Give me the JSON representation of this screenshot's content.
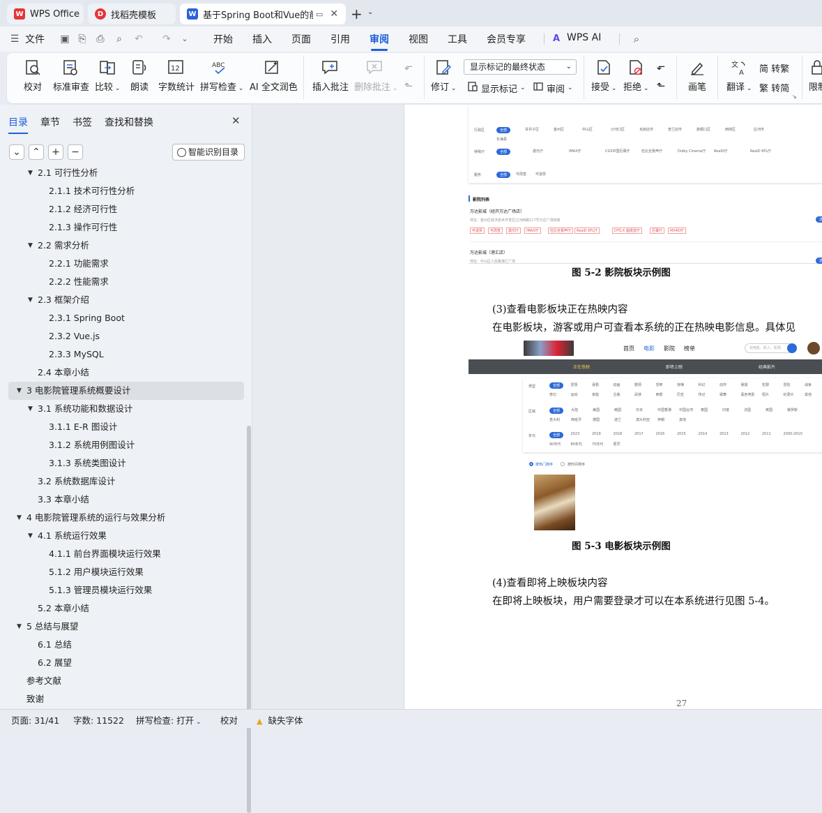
{
  "tabs": [
    {
      "label": "WPS Office",
      "logo": "W",
      "color": "#e5353a"
    },
    {
      "label": "找稻壳模板",
      "logo": "D",
      "color": "#e5353a"
    },
    {
      "label": "基于Spring Boot和Vue的前后",
      "logo": "W",
      "color": "#2b62d8"
    }
  ],
  "menu": {
    "file": "文件",
    "items": [
      "开始",
      "插入",
      "页面",
      "引用",
      "审阅",
      "视图",
      "工具",
      "会员专享"
    ],
    "active": "审阅",
    "ai": "WPS AI"
  },
  "ribbon": {
    "proofread": "校对",
    "std_review": "标准审查",
    "compare": "比较",
    "read_aloud": "朗读",
    "word_count": "字数统计",
    "spell_check": "拼写检查",
    "ai_polish": "AI 全文润色",
    "insert_comment": "插入批注",
    "delete_comment": "删除批注",
    "track": "修订",
    "markup_select": "显示标记的最终状态",
    "show_markup": "显示标记",
    "review_pane": "审阅",
    "accept": "接受",
    "reject": "拒绝",
    "pen": "画笔",
    "translate": "翻译",
    "to_trad": "简 转繁",
    "to_simp": "繁 转简",
    "restrict": "限制"
  },
  "sidebar": {
    "tabs": [
      "目录",
      "章节",
      "书签",
      "查找和替换"
    ],
    "smart_btn": "智能识别目录",
    "toc": [
      {
        "label": "2.1  可行性分析",
        "level": 2,
        "caret": true
      },
      {
        "label": "2.1.1  技术可行性分析",
        "level": 3
      },
      {
        "label": "2.1.2  经济可行性",
        "level": 3
      },
      {
        "label": "2.1.3  操作可行性",
        "level": 3
      },
      {
        "label": "2.2  需求分析",
        "level": 2,
        "caret": true
      },
      {
        "label": "2.2.1  功能需求",
        "level": 3
      },
      {
        "label": "2.2.2  性能需求",
        "level": 3
      },
      {
        "label": "2.3  框架介绍",
        "level": 2,
        "caret": true
      },
      {
        "label": "2.3.1 Spring Boot",
        "level": 3
      },
      {
        "label": "2.3.2 Vue.js",
        "level": 3
      },
      {
        "label": "2.3.3 MySQL",
        "level": 3
      },
      {
        "label": "2.4  本章小结",
        "level": 2
      },
      {
        "label": "3  电影院管理系统概要设计",
        "level": 1,
        "caret": true,
        "selected": true
      },
      {
        "label": "3.1  系统功能和数据设计",
        "level": 2,
        "caret": true
      },
      {
        "label": "3.1.1 E-R 图设计",
        "level": 3
      },
      {
        "label": "3.1.2  系统用例图设计",
        "level": 3
      },
      {
        "label": "3.1.3  系统类图设计",
        "level": 3
      },
      {
        "label": "3.2  系统数据库设计",
        "level": 2
      },
      {
        "label": "3.3  本章小结",
        "level": 2
      },
      {
        "label": "4  电影院管理系统的运行与效果分析",
        "level": 1,
        "caret": true
      },
      {
        "label": "4.1  系统运行效果",
        "level": 2,
        "caret": true
      },
      {
        "label": "4.1.1  前台界面模块运行效果",
        "level": 3
      },
      {
        "label": "5.1.2  用户模块运行效果",
        "level": 3
      },
      {
        "label": "5.1.3  管理员模块运行效果",
        "level": 3
      },
      {
        "label": "5.2  本章小结",
        "level": 2
      },
      {
        "label": "5  总结与展望",
        "level": 1,
        "caret": true
      },
      {
        "label": "6.1  总结",
        "level": 2
      },
      {
        "label": "6.2  展望",
        "level": 2
      },
      {
        "label": "参考文献",
        "level": 1
      },
      {
        "label": "致谢",
        "level": 1
      }
    ]
  },
  "document": {
    "fig52_caption": "图 5-2 影院板块示例图",
    "para3_title": "(3)查看电影板块正在热映内容",
    "para3_body": "在电影板块，游客或用户可查看本系统的正在热映电影信息。具体见",
    "fig53_caption": "图 5-3 电影板块示例图",
    "para4_title": "(4)查看即将上映板块内容",
    "para4_body": "在即将上映板块，用户需要登录才可以在本系统进行见图 5-4。",
    "page_number": "27",
    "fig52": {
      "list_title": "影院列表",
      "cinema1": "万达影城（经开万达广场店）",
      "cinema1_addr": "地址：金州区经济技术开发区辽河西路117号万达广场四楼",
      "cinema2": "万达影城（港汇店）",
      "cinema2_addr": "地址：中山区人民路港汇广场",
      "filter_district": "行政区",
      "districts": [
        "全部",
        "甘井子区",
        "金州区",
        "中山区",
        "沙河口区",
        "瓦房店市",
        "普兰店市",
        "旅顺口区",
        "西岗区",
        "庄河市",
        "长海县"
      ],
      "filter_hall": "特殊厅",
      "halls": [
        "全部",
        "激光厅",
        "IMAX厅",
        "CGS中国巨幕厅",
        "杜比全景声厅",
        "Dolby Cinema厅",
        "RealD厅",
        "RealD 6FL厅"
      ],
      "filter_service": "服务",
      "services": [
        "全部",
        "可改签",
        "可退票"
      ],
      "tags": [
        "可退票",
        "可改签",
        "激光厅",
        "IMAX厅",
        "杜比全景声厅",
        "RealD 6FL厅",
        "DTS:X 临境音厅",
        "巨幕厅",
        "MX4D厅"
      ],
      "action": "选座购票"
    },
    "fig53": {
      "nav": [
        "首页",
        "电影",
        "影院",
        "榜单"
      ],
      "search_placeholder": "找电影、影人、影院",
      "subtabs": [
        "正在热映",
        "即将上映",
        "经典影片"
      ],
      "filter_type": "类型",
      "types": [
        "全部",
        "爱情",
        "喜剧",
        "动画",
        "剧情",
        "恐怖",
        "惊悚",
        "科幻",
        "动作",
        "悬疑",
        "犯罪",
        "冒险",
        "战争",
        "奇幻",
        "运动",
        "家庭",
        "古装",
        "武侠",
        "西部",
        "历史",
        "传记",
        "歌舞",
        "黑色电影",
        "短片",
        "纪录片",
        "其他"
      ],
      "filter_region": "区域",
      "regions": [
        "全部",
        "大陆",
        "美国",
        "韩国",
        "日本",
        "中国香港",
        "中国台湾",
        "泰国",
        "印度",
        "法国",
        "英国",
        "俄罗斯",
        "意大利",
        "西班牙",
        "德国",
        "波兰",
        "澳大利亚",
        "伊朗",
        "其他"
      ],
      "filter_year": "年代",
      "years": [
        "全部",
        "2023",
        "2019",
        "2018",
        "2017",
        "2016",
        "2015",
        "2014",
        "2013",
        "2012",
        "2011",
        "2000-2010",
        "90年代",
        "80年代",
        "70年代",
        "更早"
      ],
      "sort_hot": "按热门排序",
      "sort_time": "按时间排序"
    }
  },
  "status": {
    "page": "页面: 31/41",
    "words": "字数: 11522",
    "spell": "拼写检查: 打开",
    "proof": "校对",
    "missing_font": "缺失字体"
  }
}
